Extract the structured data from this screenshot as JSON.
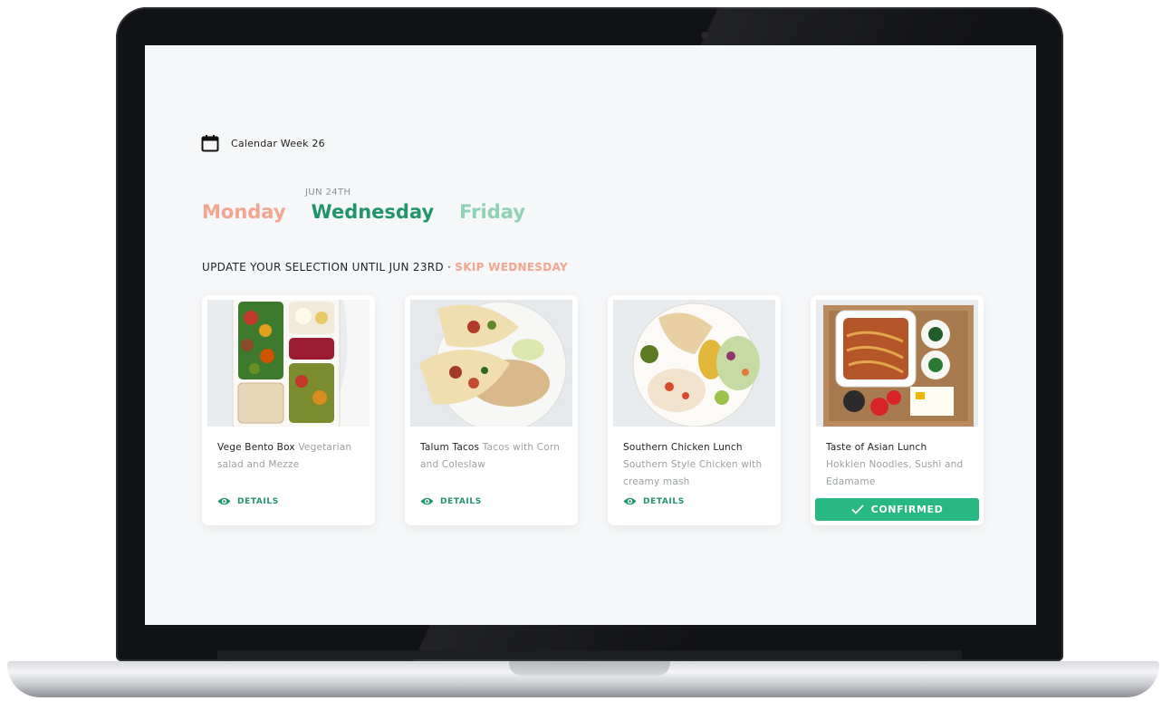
{
  "week": {
    "label": "Calendar Week 26",
    "icon": "calendar-icon"
  },
  "days": {
    "selected_date": "JUN 24TH",
    "items": [
      {
        "label": "Monday",
        "color": "#f3a58f"
      },
      {
        "label": "Wednesday",
        "color": "#22946d"
      },
      {
        "label": "Friday",
        "color": "#8dd2b4"
      }
    ]
  },
  "selection": {
    "update_text": "UPDATE YOUR SELECTION UNTIL JUN 23RD · ",
    "skip_label": "SKIP WEDNESDAY"
  },
  "meals": [
    {
      "name": "Vege Bento Box",
      "description": "Vegetarian salad and Mezze",
      "action": "DETAILS",
      "action_icon": "eye-icon"
    },
    {
      "name": "Talum Tacos",
      "description": "Tacos with Corn and Coleslaw",
      "action": "DETAILS",
      "action_icon": "eye-icon"
    },
    {
      "name": "Southern Chicken Lunch",
      "description": "Southern Style Chicken with creamy mash",
      "action": "DETAILS",
      "action_icon": "eye-icon"
    },
    {
      "name": "Taste of Asian Lunch",
      "description": "Hokkien Noodles, Sushi and Edamame",
      "confirmed_label": "CONFIRMED",
      "confirmed_icon": "check-icon"
    }
  ],
  "colors": {
    "accent_green": "#22946d",
    "confirm_green": "#27b883",
    "coral": "#f3a58f",
    "mint": "#8dd2b4"
  }
}
